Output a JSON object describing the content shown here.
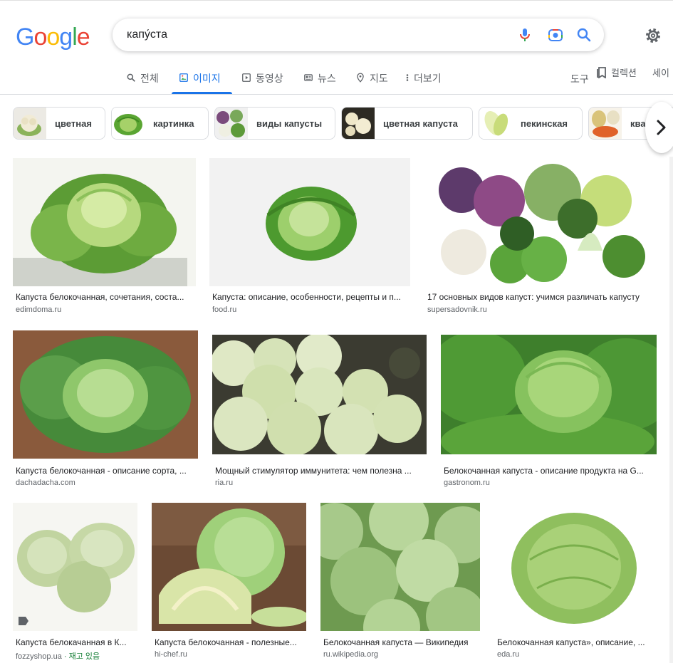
{
  "logo": {
    "letters": [
      "G",
      "o",
      "o",
      "g",
      "l",
      "e"
    ],
    "colors": [
      "#4285f4",
      "#ea4335",
      "#fbbc05",
      "#4285f4",
      "#34a853",
      "#ea4335"
    ]
  },
  "search": {
    "query": "капу́ста"
  },
  "icons": {
    "mic": "mic-icon",
    "camera": "camera-icon",
    "search": "search-icon",
    "settings": "gear-icon"
  },
  "tabs": [
    {
      "label": "전체",
      "icon": "search-icon"
    },
    {
      "label": "이미지",
      "icon": "image-icon"
    },
    {
      "label": "동영상",
      "icon": "video-icon"
    },
    {
      "label": "뉴스",
      "icon": "news-icon"
    },
    {
      "label": "지도",
      "icon": "map-pin-icon"
    },
    {
      "label": "더보기",
      "icon": "more-icon"
    }
  ],
  "toolbar": {
    "tools_label": "도구",
    "collections_label": "컬렉션",
    "share_label": "세이"
  },
  "chips": [
    {
      "label": "цветная"
    },
    {
      "label": "картинка"
    },
    {
      "label": "виды капусты"
    },
    {
      "label": "цветная капуста"
    },
    {
      "label": "пекинская"
    },
    {
      "label": "ква"
    }
  ],
  "results": [
    {
      "title": "Капуста белокочанная, сочетания, соста...",
      "source": "edimdoma.ru"
    },
    {
      "title": "Капуста: описание, особенности, рецепты и п...",
      "source": "food.ru"
    },
    {
      "title": "17 основных видов капуст: учимся различать капусту",
      "source": "supersadovnik.ru"
    },
    {
      "title": "Капуста белокочанная - описание сорта, ...",
      "source": "dachadacha.com"
    },
    {
      "title": "Мощный стимулятор иммунитета: чем полезна ...",
      "source": "ria.ru"
    },
    {
      "title": "Белокочанная капуста - описание продукта на G...",
      "source": "gastronom.ru"
    },
    {
      "title": "Капуста белокачанная в К...",
      "source": "fozzyshop.ua",
      "stock": " · 재고 있음"
    },
    {
      "title": "Капуста белокочанная - полезные...",
      "source": "hi-chef.ru"
    },
    {
      "title": "Белокочанная капуста — Википедия",
      "source": "ru.wikipedia.org"
    },
    {
      "title": "Белокочанная капуста», описание, ...",
      "source": "eda.ru"
    }
  ]
}
